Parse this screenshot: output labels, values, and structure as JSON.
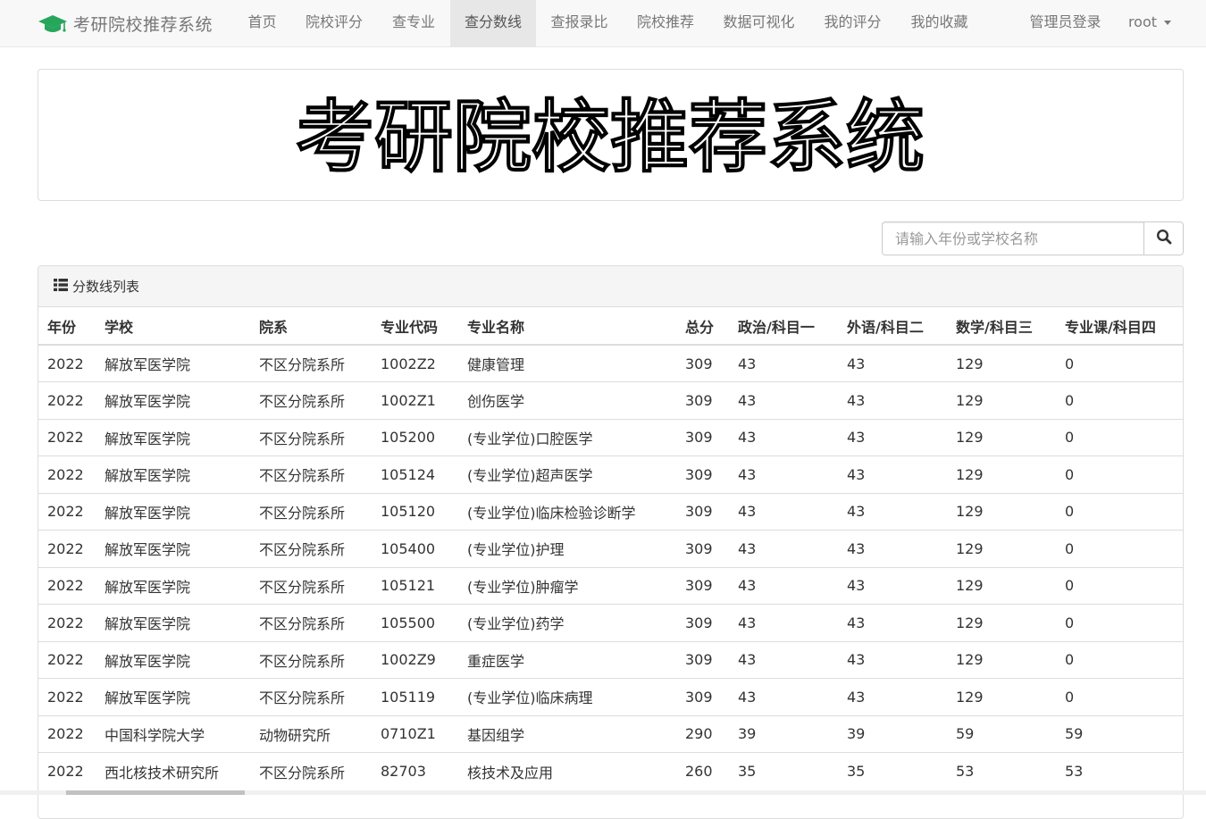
{
  "navbar": {
    "brand": "考研院校推荐系统",
    "items": [
      {
        "label": "首页"
      },
      {
        "label": "院校评分"
      },
      {
        "label": "查专业"
      },
      {
        "label": "查分数线"
      },
      {
        "label": "查报录比"
      },
      {
        "label": "院校推荐"
      },
      {
        "label": "数据可视化"
      },
      {
        "label": "我的评分"
      },
      {
        "label": "我的收藏"
      }
    ],
    "admin_login": "管理员登录",
    "user": "root",
    "active_index": 3
  },
  "banner": {
    "title": "考研院校推荐系统"
  },
  "search": {
    "placeholder": "请输入年份或学校名称"
  },
  "panel": {
    "title": "分数线列表",
    "columns": [
      "年份",
      "学校",
      "院系",
      "专业代码",
      "专业名称",
      "总分",
      "政治/科目一",
      "外语/科目二",
      "数学/科目三",
      "专业课/科目四"
    ],
    "rows": [
      [
        "2022",
        "解放军医学院",
        "不区分院系所",
        "1002Z2",
        "健康管理",
        "309",
        "43",
        "43",
        "129",
        "0"
      ],
      [
        "2022",
        "解放军医学院",
        "不区分院系所",
        "1002Z1",
        "创伤医学",
        "309",
        "43",
        "43",
        "129",
        "0"
      ],
      [
        "2022",
        "解放军医学院",
        "不区分院系所",
        "105200",
        "(专业学位)口腔医学",
        "309",
        "43",
        "43",
        "129",
        "0"
      ],
      [
        "2022",
        "解放军医学院",
        "不区分院系所",
        "105124",
        "(专业学位)超声医学",
        "309",
        "43",
        "43",
        "129",
        "0"
      ],
      [
        "2022",
        "解放军医学院",
        "不区分院系所",
        "105120",
        "(专业学位)临床检验诊断学",
        "309",
        "43",
        "43",
        "129",
        "0"
      ],
      [
        "2022",
        "解放军医学院",
        "不区分院系所",
        "105400",
        "(专业学位)护理",
        "309",
        "43",
        "43",
        "129",
        "0"
      ],
      [
        "2022",
        "解放军医学院",
        "不区分院系所",
        "105121",
        "(专业学位)肿瘤学",
        "309",
        "43",
        "43",
        "129",
        "0"
      ],
      [
        "2022",
        "解放军医学院",
        "不区分院系所",
        "105500",
        "(专业学位)药学",
        "309",
        "43",
        "43",
        "129",
        "0"
      ],
      [
        "2022",
        "解放军医学院",
        "不区分院系所",
        "1002Z9",
        "重症医学",
        "309",
        "43",
        "43",
        "129",
        "0"
      ],
      [
        "2022",
        "解放军医学院",
        "不区分院系所",
        "105119",
        "(专业学位)临床病理",
        "309",
        "43",
        "43",
        "129",
        "0"
      ],
      [
        "2022",
        "中国科学院大学",
        "动物研究所",
        "0710Z1",
        "基因组学",
        "290",
        "39",
        "39",
        "59",
        "59"
      ],
      [
        "2022",
        "西北核技术研究所",
        "不区分院系所",
        "82703",
        "核技术及应用",
        "260",
        "35",
        "35",
        "53",
        "53"
      ]
    ]
  },
  "colors": {
    "brand_icon": "#26a65b",
    "active_nav_bg": "#e7e7e7"
  },
  "icons": {
    "brand": "graduation-cap-icon",
    "search": "search-icon",
    "list": "list-icon",
    "user_menu": "caret-down-icon"
  }
}
